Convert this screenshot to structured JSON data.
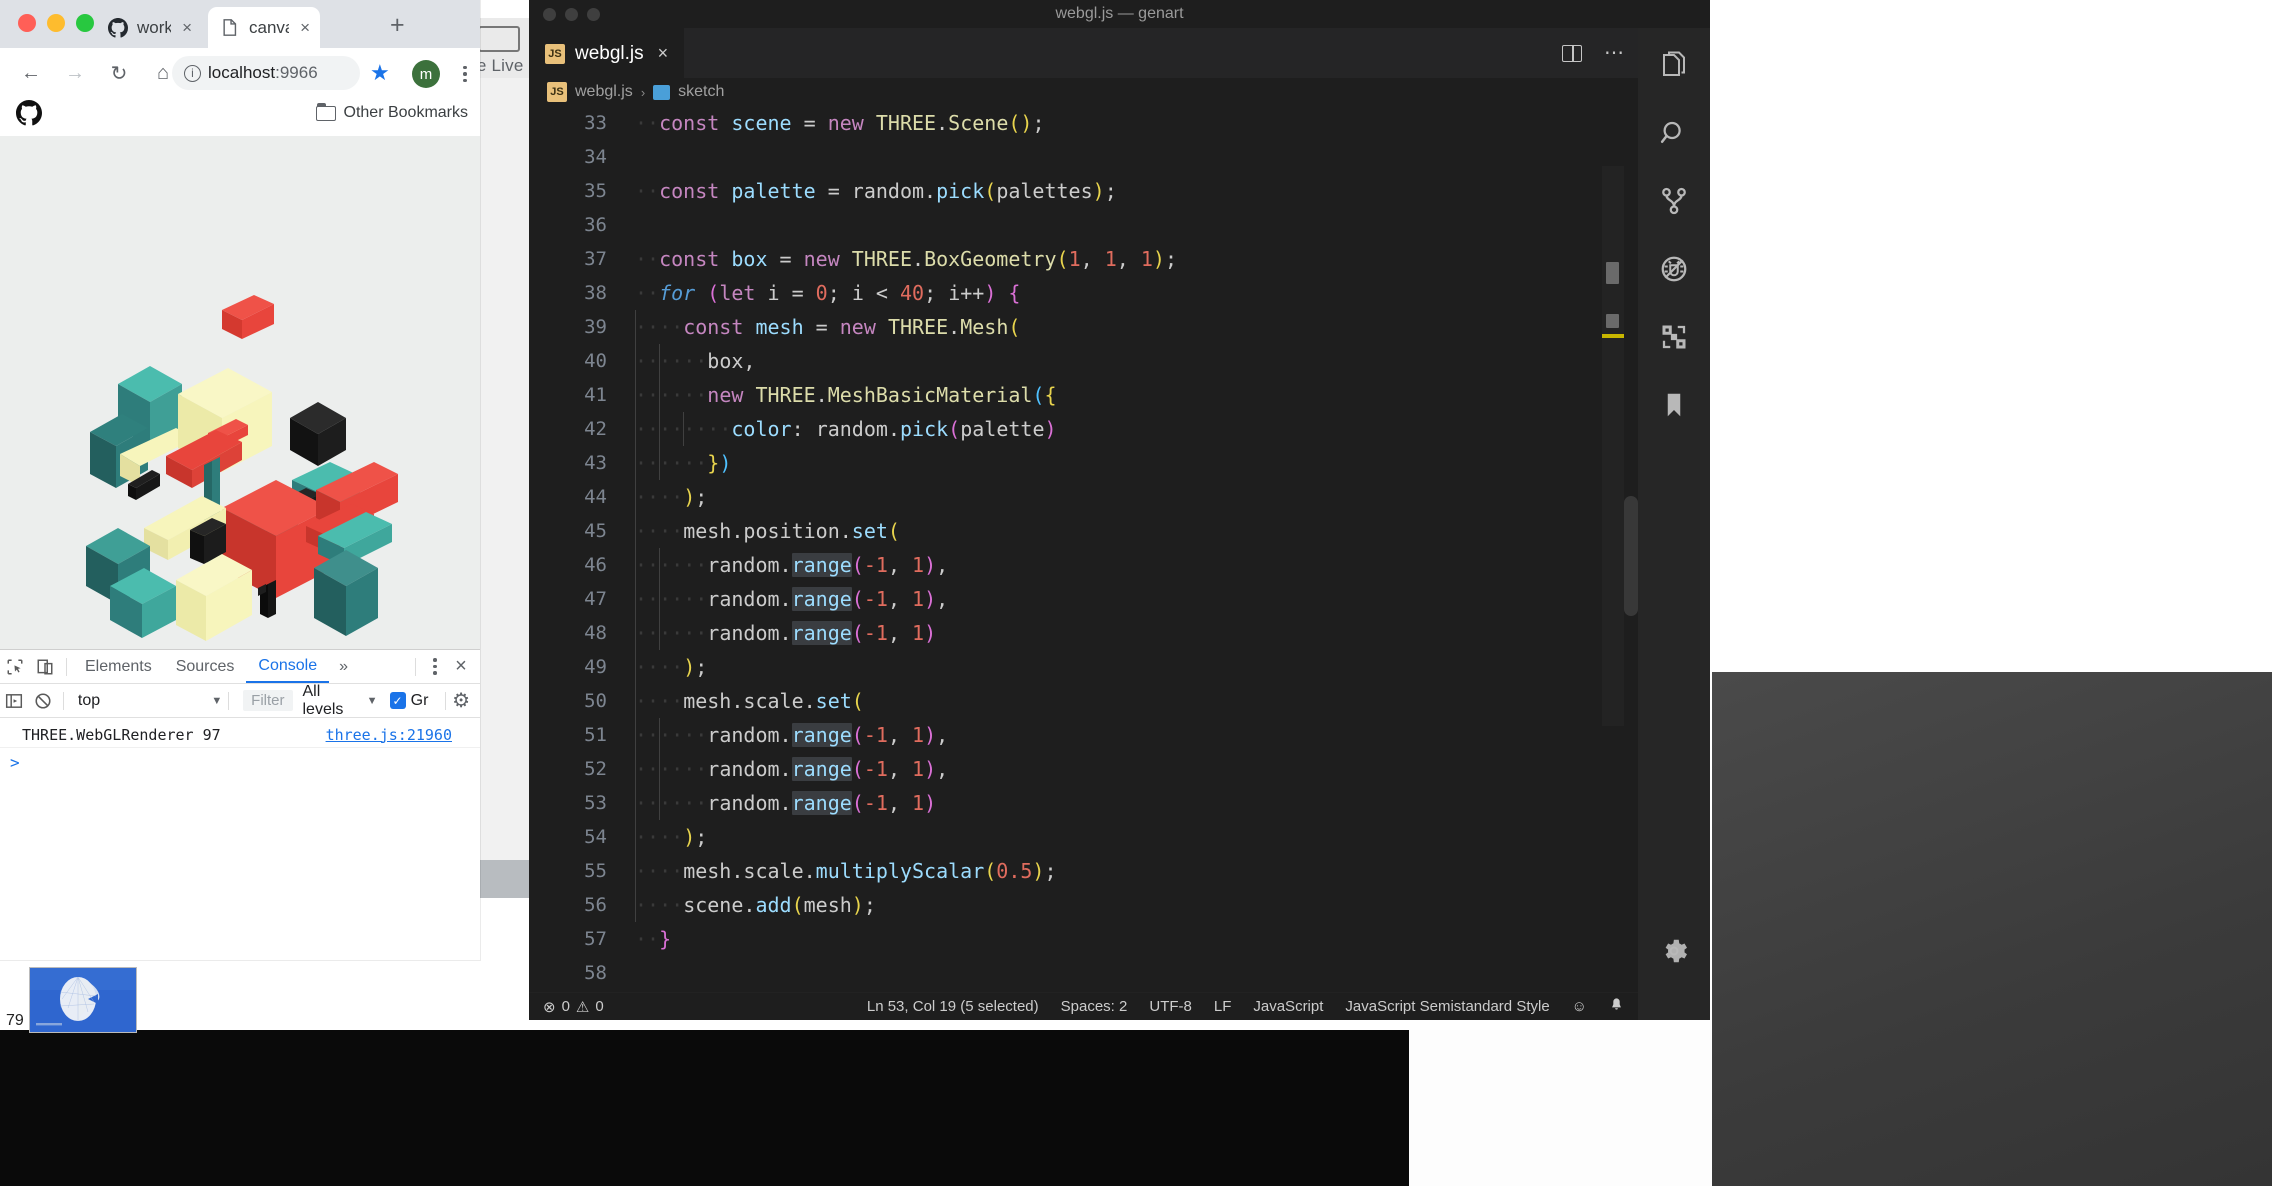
{
  "browser": {
    "tabs": [
      {
        "title": "workshop",
        "favicon": "github-icon",
        "active": false
      },
      {
        "title": "canvas-s",
        "favicon": "document-icon",
        "active": true
      }
    ],
    "new_tab_label": "+",
    "close_label": "×",
    "nav": {
      "back": "←",
      "forward": "→",
      "reload": "↻",
      "home": "⌂"
    },
    "omnibox": {
      "info_glyph": "i",
      "url_host": "localhost",
      "url_port": ":9966"
    },
    "star_glyph": "★",
    "avatar_initial": "m",
    "bookmarks": {
      "other_label": "Other Bookmarks",
      "github_bookmark": "github-icon"
    }
  },
  "devtools": {
    "tabs": [
      "Elements",
      "Sources",
      "Console"
    ],
    "active_tab": "Console",
    "more_tabs_glyph": "»",
    "close_glyph": "×",
    "context": "top",
    "context_caret": "▼",
    "filter_placeholder": "Filter",
    "levels": "All levels",
    "levels_caret": "▼",
    "group_checkbox_checked": true,
    "group_label": "Gr",
    "settings_glyph": "⚙",
    "messages": [
      {
        "text": "THREE.WebGLRenderer 97",
        "source": "three.js:21960"
      }
    ],
    "prompt_glyph": ">"
  },
  "slide": {
    "number": "79"
  },
  "vscode": {
    "window_title": "webgl.js — genart",
    "tab": {
      "label": "webgl.js",
      "badge": "JS",
      "close": "×"
    },
    "tab_actions": {
      "split_editor": "split-editor-icon",
      "more_actions": "⋯"
    },
    "breadcrumb": {
      "file_badge": "JS",
      "file": "webgl.js",
      "separator": "›",
      "symbol": "sketch"
    },
    "activity_bar": [
      {
        "name": "explorer",
        "icon": "files-icon"
      },
      {
        "name": "search",
        "icon": "search-icon"
      },
      {
        "name": "source-control",
        "icon": "branch-icon"
      },
      {
        "name": "run-and-debug",
        "icon": "debug-icon"
      },
      {
        "name": "extensions",
        "icon": "extensions-icon"
      },
      {
        "name": "bookmarks",
        "icon": "bookmark-icon"
      }
    ],
    "settings_icon": "gear-icon",
    "status_bar": {
      "errors_glyph": "⊗",
      "errors": "0",
      "warnings_glyph": "⚠",
      "warnings": "0",
      "cursor": "Ln 53, Col 19 (5 selected)",
      "indentation": "Spaces: 2",
      "encoding": "UTF-8",
      "eol": "LF",
      "language": "JavaScript",
      "linter": "JavaScript Semistandard Style",
      "feedback_glyph": "☺",
      "bell_glyph": "🔔"
    },
    "code_lines": [
      {
        "n": "33",
        "indent": 1,
        "guides": 0,
        "html": "<span class=\"kw\">const</span> <span class=\"var\">scene</span> <span class=\"punc\">=</span> <span class=\"kw\">new</span> <span class=\"fn\">THREE</span><span class=\"punc\">.</span><span class=\"fn\">Scene</span><span class=\"brace-y\">(</span><span class=\"brace-y\">)</span><span class=\"punc\">;</span>"
      },
      {
        "n": "34",
        "indent": 0,
        "guides": 0,
        "html": ""
      },
      {
        "n": "35",
        "indent": 1,
        "guides": 0,
        "html": "<span class=\"kw\">const</span> <span class=\"var\">palette</span> <span class=\"punc\">=</span> <span class=\"punc\">random</span><span class=\"punc\">.</span><span class=\"prop\">pick</span><span class=\"brace-y\">(</span><span class=\"punc\">palettes</span><span class=\"brace-y\">)</span><span class=\"punc\">;</span>"
      },
      {
        "n": "36",
        "indent": 0,
        "guides": 0,
        "html": ""
      },
      {
        "n": "37",
        "indent": 1,
        "guides": 0,
        "html": "<span class=\"kw\">const</span> <span class=\"var\">box</span> <span class=\"punc\">=</span> <span class=\"kw\">new</span> <span class=\"fn\">THREE</span><span class=\"punc\">.</span><span class=\"fn\">BoxGeometry</span><span class=\"brace-y\">(</span><span class=\"numr\">1</span><span class=\"punc\">, </span><span class=\"numr\">1</span><span class=\"punc\">, </span><span class=\"numr\">1</span><span class=\"brace-y\">)</span><span class=\"punc\">;</span>"
      },
      {
        "n": "38",
        "indent": 1,
        "guides": 0,
        "html": "<span class=\"ital\">for</span> <span class=\"brace-p\">(</span><span class=\"kw\">let</span> <span class=\"punc\">i</span> <span class=\"punc\">=</span> <span class=\"numr\">0</span><span class=\"punc\">; </span><span class=\"punc\">i</span> <span class=\"punc\">&lt;</span> <span class=\"numr\">40</span><span class=\"punc\">; </span><span class=\"punc\">i</span><span class=\"punc\">++</span><span class=\"brace-p\">)</span> <span class=\"brace-p\">{</span>"
      },
      {
        "n": "39",
        "indent": 2,
        "guides": 1,
        "html": "<span class=\"kw\">const</span> <span class=\"var\">mesh</span> <span class=\"punc\">=</span> <span class=\"kw\">new</span> <span class=\"fn\">THREE</span><span class=\"punc\">.</span><span class=\"fn\">Mesh</span><span class=\"brace-y\">(</span>"
      },
      {
        "n": "40",
        "indent": 3,
        "guides": 2,
        "html": "<span class=\"punc\">box</span><span class=\"punc\">,</span>"
      },
      {
        "n": "41",
        "indent": 3,
        "guides": 2,
        "html": "<span class=\"kw\">new</span> <span class=\"fn\">THREE</span><span class=\"punc\">.</span><span class=\"fn\">MeshBasicMaterial</span><span class=\"brace-b\">(</span><span class=\"brace-y\">{</span>"
      },
      {
        "n": "42",
        "indent": 4,
        "guides": 3,
        "html": "<span class=\"prop\">color</span><span class=\"punc\">: </span><span class=\"punc\">random</span><span class=\"punc\">.</span><span class=\"prop\">pick</span><span class=\"brace-p\">(</span><span class=\"punc\">palette</span><span class=\"brace-p\">)</span>"
      },
      {
        "n": "43",
        "indent": 3,
        "guides": 2,
        "html": "<span class=\"brace-y\">}</span><span class=\"brace-b\">)</span>"
      },
      {
        "n": "44",
        "indent": 2,
        "guides": 1,
        "html": "<span class=\"brace-y\">)</span><span class=\"punc\">;</span>"
      },
      {
        "n": "45",
        "indent": 2,
        "guides": 1,
        "html": "<span class=\"punc\">mesh</span><span class=\"punc\">.</span><span class=\"punc\">position</span><span class=\"punc\">.</span><span class=\"prop\">set</span><span class=\"brace-y\">(</span>"
      },
      {
        "n": "46",
        "indent": 3,
        "guides": 2,
        "html": "<span class=\"punc\">random</span><span class=\"punc\">.</span><span class=\"sel prop\">range</span><span class=\"brace-p\">(</span><span class=\"numr\">-1</span><span class=\"punc\">, </span><span class=\"numr\">1</span><span class=\"brace-p\">)</span><span class=\"punc\">,</span>"
      },
      {
        "n": "47",
        "indent": 3,
        "guides": 2,
        "html": "<span class=\"punc\">random</span><span class=\"punc\">.</span><span class=\"sel prop\">range</span><span class=\"brace-p\">(</span><span class=\"numr\">-1</span><span class=\"punc\">, </span><span class=\"numr\">1</span><span class=\"brace-p\">)</span><span class=\"punc\">,</span>"
      },
      {
        "n": "48",
        "indent": 3,
        "guides": 2,
        "html": "<span class=\"punc\">random</span><span class=\"punc\">.</span><span class=\"sel prop\">range</span><span class=\"brace-p\">(</span><span class=\"numr\">-1</span><span class=\"punc\">, </span><span class=\"numr\">1</span><span class=\"brace-p\">)</span>"
      },
      {
        "n": "49",
        "indent": 2,
        "guides": 1,
        "html": "<span class=\"brace-y\">)</span><span class=\"punc\">;</span>"
      },
      {
        "n": "50",
        "indent": 2,
        "guides": 1,
        "html": "<span class=\"punc\">mesh</span><span class=\"punc\">.</span><span class=\"punc\">scale</span><span class=\"punc\">.</span><span class=\"prop\">set</span><span class=\"brace-y\">(</span>"
      },
      {
        "n": "51",
        "indent": 3,
        "guides": 2,
        "html": "<span class=\"punc\">random</span><span class=\"punc\">.</span><span class=\"sel prop\">range</span><span class=\"brace-p\">(</span><span class=\"numr\">-1</span><span class=\"punc\">, </span><span class=\"numr\">1</span><span class=\"brace-p\">)</span><span class=\"punc\">,</span>"
      },
      {
        "n": "52",
        "indent": 3,
        "guides": 2,
        "html": "<span class=\"punc\">random</span><span class=\"punc\">.</span><span class=\"sel prop\">range</span><span class=\"brace-p\">(</span><span class=\"numr\">-1</span><span class=\"punc\">, </span><span class=\"numr\">1</span><span class=\"brace-p\">)</span><span class=\"punc\">,</span>"
      },
      {
        "n": "53",
        "indent": 3,
        "guides": 2,
        "html": "<span class=\"punc\">random</span><span class=\"punc\">.</span><span class=\"sel prop\">range</span><span class=\"brace-p\">(</span><span class=\"numr\">-1</span><span class=\"punc\">, </span><span class=\"numr\">1</span><span class=\"brace-p\">)</span>"
      },
      {
        "n": "54",
        "indent": 2,
        "guides": 1,
        "html": "<span class=\"brace-y\">)</span><span class=\"punc\">;</span>"
      },
      {
        "n": "55",
        "indent": 2,
        "guides": 1,
        "html": "<span class=\"punc\">mesh</span><span class=\"punc\">.</span><span class=\"punc\">scale</span><span class=\"punc\">.</span><span class=\"prop\">multiplyScalar</span><span class=\"brace-y\">(</span><span class=\"numr\">0.5</span><span class=\"brace-y\">)</span><span class=\"punc\">;</span>"
      },
      {
        "n": "56",
        "indent": 2,
        "guides": 1,
        "html": "<span class=\"punc\">scene</span><span class=\"punc\">.</span><span class=\"prop\">add</span><span class=\"brace-y\">(</span><span class=\"punc\">mesh</span><span class=\"brace-y\">)</span><span class=\"punc\">;</span>"
      },
      {
        "n": "57",
        "indent": 1,
        "guides": 0,
        "html": "<span class=\"brace-p\">}</span>"
      },
      {
        "n": "58",
        "indent": 0,
        "guides": 0,
        "html": ""
      }
    ]
  },
  "background_window": {
    "label": "te Live"
  },
  "artwork": {
    "description": "isometric-cubes-generative-art",
    "background": "#eceeed",
    "palette": [
      "#e8453c",
      "#4bbcae",
      "#f7f5bc",
      "#2e7d7b",
      "#1a1a1a",
      "#3f8f8c"
    ]
  }
}
